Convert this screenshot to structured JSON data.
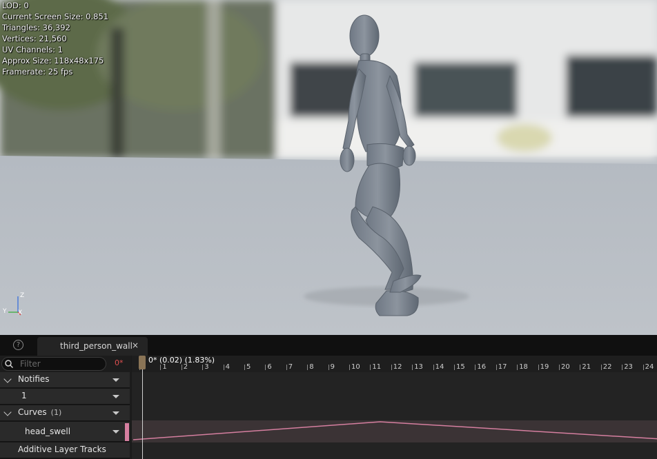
{
  "viewport": {
    "stats": [
      "LOD: 0",
      "Current Screen Size: 0.851",
      "Triangles: 36,392",
      "Vertices: 21,560",
      "UV Channels: 1",
      "Approx Size: 118x48x175",
      "Framerate: 25 fps"
    ],
    "axis": {
      "z": "Z",
      "y": "Y",
      "x": "X"
    }
  },
  "tabbar": {
    "help_icon": "help-icon",
    "tab_label": "third_person_wall",
    "tab_close": "×"
  },
  "left_panel": {
    "filter_placeholder": "Filter",
    "filter_count": "0*",
    "notifies": {
      "label": "Notifies"
    },
    "notify_track": {
      "label": "1"
    },
    "curves": {
      "label": "Curves",
      "count": "(1)"
    },
    "curve_item": {
      "label": "head_swell",
      "color": "#d67fa0"
    },
    "additive": {
      "label": "Additive Layer Tracks"
    }
  },
  "timeline": {
    "current_time": "0* (0.02) (1.83%)",
    "frames": [
      "0",
      "1",
      "2",
      "3",
      "4",
      "5",
      "6",
      "7",
      "8",
      "9",
      "10",
      "11",
      "12",
      "13",
      "14",
      "15",
      "16",
      "17",
      "18",
      "19",
      "20",
      "21",
      "22",
      "23",
      "24"
    ],
    "curve_color": "#d67fa0",
    "curve_values": [
      0.0,
      1.0,
      0.0
    ],
    "curve_keys": [
      0,
      11,
      24
    ]
  }
}
